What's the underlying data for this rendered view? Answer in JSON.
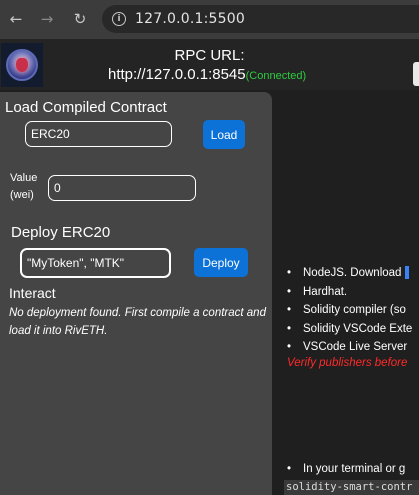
{
  "browser": {
    "url": "127.0.0.1:5500"
  },
  "header": {
    "rpc_label": "RPC URL:",
    "rpc_url": "http://127.0.0.1:8545",
    "rpc_status": "(Connected)",
    "status_color": "#2ecc40"
  },
  "load_section": {
    "title": "Load Compiled Contract",
    "contract_value": "ERC20",
    "load_label": "Load"
  },
  "value_section": {
    "label_line1": "Value",
    "label_line2": "(wei)",
    "value": "0"
  },
  "deploy_section": {
    "title": "Deploy ERC20",
    "args_value": "\"MyToken\", \"MTK\"",
    "deploy_label": "Deploy"
  },
  "interact_section": {
    "title": "Interact",
    "note": "No deployment found. First compile a contract and load it into RivETH."
  },
  "requirements": {
    "items": [
      "NodeJS. Download",
      "Hardhat.",
      "Solidity compiler (so",
      "Solidity VSCode Exte",
      "VSCode Live Server"
    ],
    "warning": "Verify publishers before",
    "terminal_item": "In your terminal or g",
    "code": "solidity-smart-contr"
  },
  "colors": {
    "accent": "#0d72d8",
    "panel": "#454545",
    "background": "#1f1f1f",
    "warning": "#ff2a2a"
  }
}
